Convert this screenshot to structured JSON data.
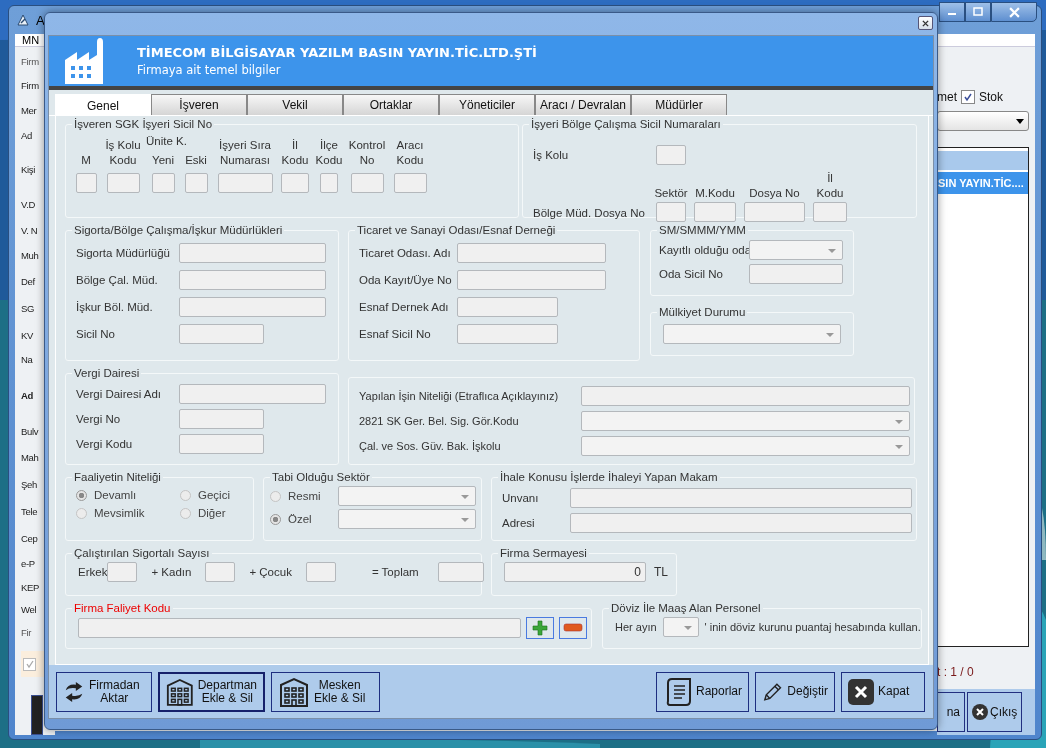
{
  "background_window": {
    "title": "A",
    "menu": "MN",
    "left_labels": [
      {
        "text": "Firm",
        "kind": "legend"
      },
      {
        "text": "Firm",
        "kind": "label"
      },
      {
        "text": "Mer",
        "kind": "label"
      },
      {
        "text": "Ad",
        "kind": "label"
      },
      {
        "text": "Kişi",
        "kind": "label"
      },
      {
        "text": "V.D",
        "kind": "label"
      },
      {
        "text": "V. N",
        "kind": "label"
      },
      {
        "text": "Muh",
        "kind": "label"
      },
      {
        "text": "Def",
        "kind": "label"
      },
      {
        "text": "SG",
        "kind": "label"
      },
      {
        "text": "KV",
        "kind": "label"
      },
      {
        "text": "Na",
        "kind": "label"
      },
      {
        "text": "Ad",
        "kind": "heading"
      },
      {
        "text": "Bulv",
        "kind": "label"
      },
      {
        "text": "Mah",
        "kind": "label"
      },
      {
        "text": "Şeh",
        "kind": "label"
      },
      {
        "text": "Tele",
        "kind": "label"
      },
      {
        "text": "Cep",
        "kind": "label"
      },
      {
        "text": "e-P",
        "kind": "label"
      },
      {
        "text": "KEP",
        "kind": "label"
      },
      {
        "text": "Wel",
        "kind": "label"
      },
      {
        "text": "Fir",
        "kind": "legend"
      }
    ],
    "left_checkbox": {
      "checked": true
    },
    "partial_label": "met",
    "stok": {
      "label": "Stok",
      "checked": true
    },
    "selected_row": "SIN YAYIN.TİC....",
    "counter": "t : 1 / 0",
    "buttons": [
      {
        "label": "na",
        "kind": "plain"
      },
      {
        "label": "Çıkış",
        "kind": "exit"
      }
    ]
  },
  "dialog": {
    "company": "TİMECOM BİLGİSAYAR YAZILM BASIN YAYIN.TİC.LTD.ŞTİ",
    "subtitle": "Firmaya ait temel bilgiler",
    "tabs": [
      {
        "label": "Genel",
        "selected": true
      },
      {
        "label": "İşveren",
        "selected": false
      },
      {
        "label": "Vekil",
        "selected": false
      },
      {
        "label": "Ortaklar",
        "selected": false
      },
      {
        "label": "Yöneticiler",
        "selected": false
      },
      {
        "label": "Aracı / Devralan",
        "selected": false
      },
      {
        "label": "Müdürler",
        "selected": false
      }
    ],
    "sgk": {
      "title": "İşveren SGK İşyeri Sicil No",
      "unit_heading": "Ünite K.",
      "columns": [
        "M",
        "İş Kolu\nKodu",
        "Yeni",
        "Eski",
        "İşyeri Sıra\nNumarası",
        "İl\nKodu",
        "İlçe\nKodu",
        "Kontrol\nNo",
        "Aracı\nKodu"
      ]
    },
    "bolge": {
      "title": "İşyeri Bölge Çalışma Sicil Numaraları",
      "is_kolu": "İş Kolu",
      "dosya": "Bölge Müd. Dosya No",
      "columns": [
        "Sektör",
        "M.Kodu",
        "Dosya No",
        "İl Kodu"
      ]
    },
    "sigorta": {
      "title": "Sigorta/Bölge Çalışma/İşkur Müdürlükleri",
      "fields": [
        {
          "label": "Sigorta Müdürlüğü",
          "kind": "text"
        },
        {
          "label": "Bölge Çal. Müd.",
          "kind": "text"
        },
        {
          "label": "İşkur Böl. Müd.",
          "kind": "text"
        },
        {
          "label": "Sicil No",
          "kind": "short"
        }
      ]
    },
    "ticaret": {
      "title": "Ticaret ve Sanayi Odası/Esnaf Derneği",
      "fields": [
        {
          "label": "Ticaret Odası. Adı",
          "kind": "text"
        },
        {
          "label": "Oda Kayıt/Üye No",
          "kind": "text"
        },
        {
          "label": "Esnaf Dernek Adı",
          "kind": "short"
        },
        {
          "label": "Esnaf Sicil No",
          "kind": "short"
        }
      ]
    },
    "smmm": {
      "title": "SM/SMMM/YMM",
      "fields": [
        {
          "label": "Kayıtlı olduğu oda",
          "kind": "select"
        },
        {
          "label": "Oda Sicil No",
          "kind": "text"
        }
      ]
    },
    "mulkiyet": {
      "title": "Mülkiyet Durumu"
    },
    "vergi": {
      "title": "Vergi Dairesi",
      "fields": [
        {
          "label": "Vergi Dairesi Adı",
          "kind": "text"
        },
        {
          "label": "Vergi No",
          "kind": "short"
        },
        {
          "label": "Vergi Kodu",
          "kind": "short"
        }
      ]
    },
    "is_niteligi": {
      "fields": [
        {
          "label": "Yapılan İşin Niteliği (Etraflıca Açıklayınız)",
          "kind": "text"
        },
        {
          "label": "2821 SK Ger. Bel. Sig. Gör.Kodu",
          "kind": "select"
        },
        {
          "label": "Çal. ve Sos. Güv. Bak. İşkolu",
          "kind": "select"
        }
      ]
    },
    "faaliyet": {
      "title": "Faaliyetin Niteliği",
      "options": [
        {
          "label": "Devamlı",
          "selected": true
        },
        {
          "label": "Geçici",
          "selected": false
        },
        {
          "label": "Mevsimlik",
          "selected": false
        },
        {
          "label": "Diğer",
          "selected": false
        }
      ]
    },
    "sektor": {
      "title": "Tabi Olduğu Sektör",
      "options": [
        {
          "label": "Resmi",
          "selected": false
        },
        {
          "label": "Özel",
          "selected": true
        }
      ]
    },
    "ihale": {
      "title": "İhale Konusu İşlerde İhaleyi Yapan Makam",
      "fields": [
        {
          "label": "Unvanı",
          "kind": "text"
        },
        {
          "label": "Adresi",
          "kind": "text"
        }
      ]
    },
    "sigortali": {
      "title": "Çalıştırılan Sigortalı Sayısı",
      "parts": [
        "Erkek",
        "+ Kadın",
        "+ Çocuk",
        "= Toplam"
      ]
    },
    "sermaye": {
      "title": "Firma Sermayesi",
      "value": "0",
      "unit": "TL"
    },
    "faliyet_kodu": {
      "title": "Firma Faliyet Kodu"
    },
    "doviz": {
      "title": "Döviz İle Maaş Alan Personel",
      "before": "Her ayın",
      "after": "' inin döviz kurunu puantaj hesabında kullan."
    },
    "left_buttons": [
      {
        "label": "Firmadan\nAktar",
        "focused": false
      },
      {
        "label": "Departman\nEkle & Sil",
        "focused": true
      },
      {
        "label": "Mesken\nEkle & Sil",
        "focused": false
      }
    ],
    "right_buttons": [
      {
        "label": "Raporlar"
      },
      {
        "label": "Değiştir"
      },
      {
        "label": "Kapat"
      }
    ]
  }
}
